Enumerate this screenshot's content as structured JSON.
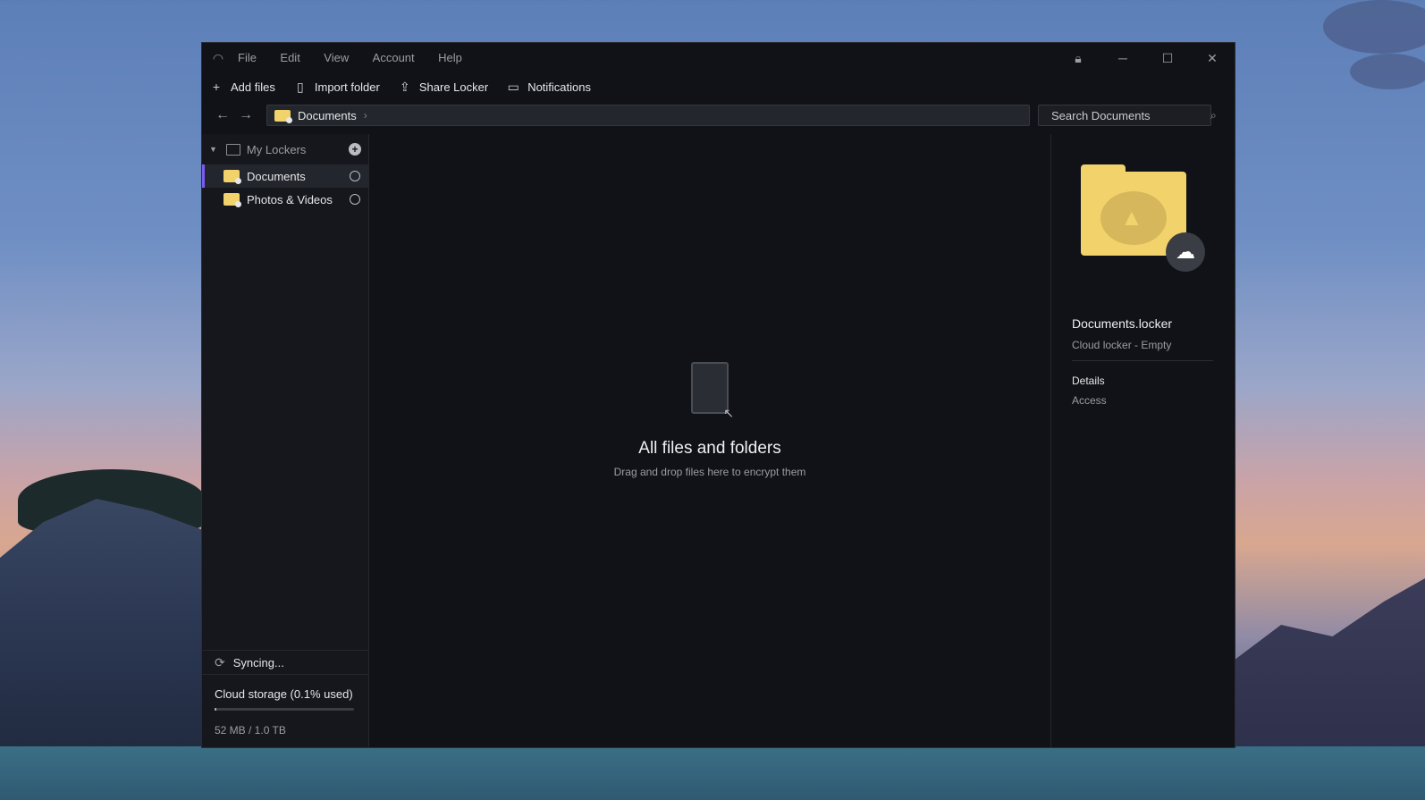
{
  "menu": [
    "File",
    "Edit",
    "View",
    "Account",
    "Help"
  ],
  "toolbar": {
    "add_files": "Add files",
    "import_folder": "Import folder",
    "share_locker": "Share Locker",
    "notifications": "Notifications"
  },
  "navigation": {
    "breadcrumb": "Documents",
    "search_placeholder": "Search Documents"
  },
  "sidebar": {
    "header": "My Lockers",
    "items": [
      {
        "label": "Documents",
        "active": true
      },
      {
        "label": "Photos & Videos",
        "active": false
      }
    ],
    "sync_status": "Syncing...",
    "storage_title": "Cloud storage (0.1% used)",
    "storage_used_fraction": 0.001,
    "storage_size": "52 MB / 1.0 TB"
  },
  "main": {
    "empty_title": "All files and folders",
    "empty_subtitle": "Drag and drop files here to encrypt them"
  },
  "details": {
    "name": "Documents.locker",
    "subtitle": "Cloud locker - Empty",
    "section": "Details",
    "access": "Access"
  },
  "colors": {
    "accent": "#7a5cf0",
    "folder": "#f2d36b",
    "window_bg": "#101217"
  }
}
